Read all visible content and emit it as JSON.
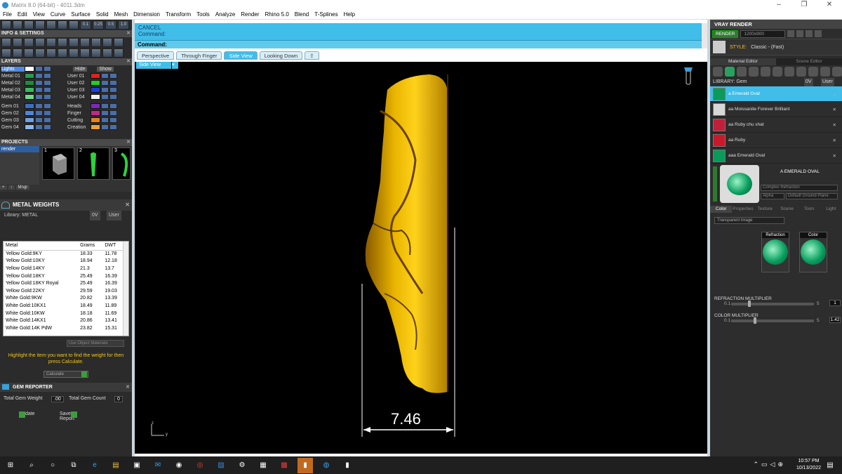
{
  "window": {
    "title": "Matrix 8.0 (64-bit) - 4011.3dm"
  },
  "menu": [
    "File",
    "Edit",
    "View",
    "Curve",
    "Surface",
    "Solid",
    "Mesh",
    "Dimension",
    "Transform",
    "Tools",
    "Analyze",
    "Render",
    "Rhino 5.0",
    "Blend",
    "T-Splines",
    "Help"
  ],
  "left": {
    "info_title": "INFO & SETTINGS",
    "layers_title": "LAYERS",
    "layers_header": {
      "lights": "Lights",
      "hide": "Hide",
      "show": "Show"
    },
    "layers_left": [
      {
        "name": "Metal 01",
        "color": "#2a9a4a"
      },
      {
        "name": "Metal 02",
        "color": "#1e8a3e"
      },
      {
        "name": "Metal 03",
        "color": "#3bb860"
      },
      {
        "name": "Metal 04",
        "color": "#6fd88a"
      },
      {
        "name": "Gem 01",
        "color": "#3a6fc4"
      },
      {
        "name": "Gem 02",
        "color": "#4f86d8"
      },
      {
        "name": "Gem 03",
        "color": "#6fa0e4"
      },
      {
        "name": "Gem 04",
        "color": "#8ab8f0"
      }
    ],
    "layers_right": [
      {
        "name": "User 01",
        "color": "#e02020"
      },
      {
        "name": "User 02",
        "color": "#20d020"
      },
      {
        "name": "User 03",
        "color": "#1f40d8"
      },
      {
        "name": "User 04",
        "color": "#f0f0f0"
      },
      {
        "name": "Heads",
        "color": "#7a2ab8"
      },
      {
        "name": "Finger",
        "color": "#c02a8a"
      },
      {
        "name": "Cutting",
        "color": "#e88020"
      },
      {
        "name": "Creation",
        "color": "#f0a030"
      }
    ],
    "projects_title": "PROJECTS",
    "project_selected": "render",
    "project_thumbs": [
      "1",
      "2",
      "3"
    ],
    "project_buttons": [
      "+",
      "↑",
      "Mngr"
    ],
    "metal_weights_title": "METAL WEIGHTS",
    "metal_library": "Library: METAL",
    "metal_lib_buttons": [
      "0V",
      "User"
    ],
    "metal_columns": [
      "Metal",
      "Grams",
      "DWT"
    ],
    "metal_rows": [
      [
        "Yellow Gold:9KY",
        "18.33",
        "11.78"
      ],
      [
        "Yellow Gold:10KY",
        "18.94",
        "12.18"
      ],
      [
        "Yellow Gold:14KY",
        "21.3",
        "13.7"
      ],
      [
        "Yellow Gold:18KY",
        "25.49",
        "16.39"
      ],
      [
        "Yellow Gold:18KY Royal",
        "25.49",
        "16.39"
      ],
      [
        "Yellow Gold:22KY",
        "29.59",
        "19.03"
      ],
      [
        "White Gold:9KW",
        "20.82",
        "13.39"
      ],
      [
        "White Gold:10KX1",
        "18.49",
        "11.89"
      ],
      [
        "White Gold:10KW",
        "18.18",
        "11.69"
      ],
      [
        "White Gold:14KX1",
        "20.86",
        "13.41"
      ],
      [
        "White Gold:14K PdW",
        "23.82",
        "15.31"
      ]
    ],
    "use_object_materials": "Use Object Materials",
    "hint": "Highlight the item you want to find the weight for then press Calculate.",
    "calculate": "Calculate",
    "gem_reporter_title": "GEM REPORTER",
    "total_gem_weight_label": "Total Gem Weight",
    "total_gem_weight": ".00",
    "total_gem_count_label": "Total Gem Count",
    "total_gem_count": "0",
    "update": "Update",
    "save_report": "Save Report"
  },
  "command": {
    "line1": "CANCEL",
    "line2": "Command:",
    "prompt": "Command:"
  },
  "viewport_tabs": [
    {
      "label": "Perspective",
      "active": false
    },
    {
      "label": "Through Finger",
      "active": false
    },
    {
      "label": "Side View",
      "active": true
    },
    {
      "label": "Looking Down",
      "active": false
    }
  ],
  "viewport": {
    "label": "Side View",
    "dimension": "7.46",
    "axis_z": "z",
    "axis_y": "y"
  },
  "right": {
    "title": "VRAY RENDER",
    "render_btn": "RENDER",
    "resolution": "1200x900",
    "style_label": "STYLE:",
    "style_value": "Classic - (Fast)",
    "tabs": [
      "Material Editor",
      "Scene Editor"
    ],
    "library": "LIBRARY: Gem",
    "lib_buttons": [
      "0V",
      "User"
    ],
    "materials": [
      {
        "name": "a Emerald Oval",
        "color": "#0a9a5a",
        "selected": true
      },
      {
        "name": "aa Moissanite Forever Brilliant",
        "color": "#d8d8d8",
        "selected": false
      },
      {
        "name": "aa Ruby chu shat",
        "color": "#c0203a",
        "selected": false
      },
      {
        "name": "aa Ruby",
        "color": "#c81a2a",
        "selected": false
      },
      {
        "name": "aaa Emerald Oval",
        "color": "#0a9a5a",
        "selected": false
      }
    ],
    "preview_name": "A EMERALD OVAL",
    "refraction_mode": "Complex Refraction",
    "alpha": "Alpha",
    "ground": "Default Ground Plane",
    "subtabs": [
      "Color",
      "Properties",
      "Texture",
      "Scene",
      "Toon",
      "Light"
    ],
    "transparent": "Transparent Image",
    "map_refraction": "Refraction",
    "map_color": "Color",
    "refraction_mult_label": "REFRACTION MULTIPLIER",
    "refraction_min": "0.1",
    "refraction_max": "5",
    "refraction_value": "1",
    "color_mult_label": "COLOR MULTIPLIER",
    "color_min": "0.1",
    "color_max": "5",
    "color_value": "1.42"
  },
  "taskbar": {
    "time": "10:57 PM",
    "date": "10/13/2022"
  }
}
